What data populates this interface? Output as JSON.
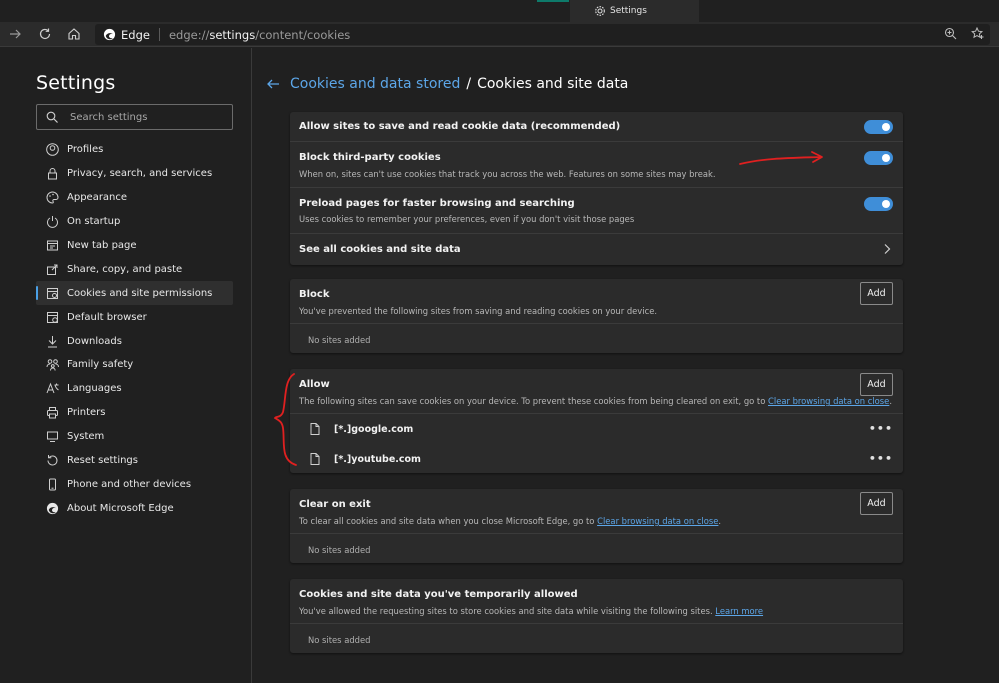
{
  "window": {
    "tab_title": "Settings"
  },
  "toolbar": {
    "brand": "Edge",
    "url_scheme": "edge://",
    "url_host": "settings",
    "url_path": "/content/cookies"
  },
  "sidebar": {
    "title": "Settings",
    "search_placeholder": "Search settings",
    "items": [
      {
        "label": "Profiles",
        "icon": "profile-icon"
      },
      {
        "label": "Privacy, search, and services",
        "icon": "lock-icon"
      },
      {
        "label": "Appearance",
        "icon": "appearance-icon"
      },
      {
        "label": "On startup",
        "icon": "power-icon"
      },
      {
        "label": "New tab page",
        "icon": "new-tab-icon"
      },
      {
        "label": "Share, copy, and paste",
        "icon": "share-icon"
      },
      {
        "label": "Cookies and site permissions",
        "icon": "cookies-icon",
        "active": true
      },
      {
        "label": "Default browser",
        "icon": "default-browser-icon"
      },
      {
        "label": "Downloads",
        "icon": "download-icon"
      },
      {
        "label": "Family safety",
        "icon": "family-icon"
      },
      {
        "label": "Languages",
        "icon": "languages-icon"
      },
      {
        "label": "Printers",
        "icon": "printer-icon"
      },
      {
        "label": "System",
        "icon": "system-icon"
      },
      {
        "label": "Reset settings",
        "icon": "reset-icon"
      },
      {
        "label": "Phone and other devices",
        "icon": "phone-icon"
      },
      {
        "label": "About Microsoft Edge",
        "icon": "edge-logo-icon"
      }
    ]
  },
  "header": {
    "breadcrumb_parent": "Cookies and data stored",
    "breadcrumb_sep": "/",
    "breadcrumb_current": "Cookies and site data"
  },
  "settings": {
    "allow_save": {
      "title": "Allow sites to save and read cookie data (recommended)",
      "enabled": true
    },
    "block_third_party": {
      "title": "Block third-party cookies",
      "desc": "When on, sites can't use cookies that track you across the web. Features on some sites may break.",
      "enabled": true
    },
    "preload": {
      "title": "Preload pages for faster browsing and searching",
      "desc": "Uses cookies to remember your preferences, even if you don't visit those pages",
      "enabled": true
    },
    "see_all": {
      "title": "See all cookies and site data"
    }
  },
  "block": {
    "title": "Block",
    "desc": "You've prevented the following sites from saving and reading cookies on your device.",
    "add_label": "Add",
    "empty": "No sites added"
  },
  "allow": {
    "title": "Allow",
    "desc": "The following sites can save cookies on your device. To prevent these cookies from being cleared on exit, go to ",
    "desc_link": "Clear browsing data on close",
    "desc_end": ".",
    "add_label": "Add",
    "sites": [
      "[*.]google.com",
      "[*.]youtube.com"
    ],
    "more_label": "•••"
  },
  "clear_on_exit": {
    "title": "Clear on exit",
    "desc": "To clear all cookies and site data when you close Microsoft Edge, go to ",
    "desc_link": "Clear browsing data on close",
    "desc_end": ".",
    "add_label": "Add",
    "empty": "No sites added"
  },
  "temp_allowed": {
    "title": "Cookies and site data you've temporarily allowed",
    "desc": "You've allowed the requesting sites to store cookies and site data while visiting the following sites. ",
    "desc_link": "Learn more",
    "empty": "No sites added"
  },
  "colors": {
    "accent": "#3f8ed8",
    "link": "#5ca6e8",
    "annotation": "#e02020"
  }
}
